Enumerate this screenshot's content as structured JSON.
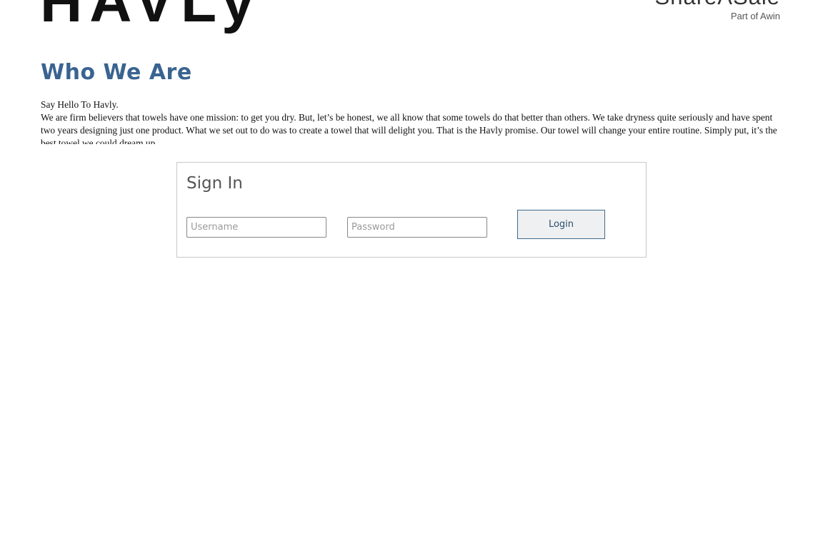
{
  "header": {
    "logo_text": "HAVLy",
    "brand_name": "ShareASale",
    "brand_sub": "Part of Awin"
  },
  "main": {
    "title": "Who We Are",
    "intro_heading": "Say Hello To Havly.",
    "intro_body": "We are firm believers that towels have one mission: to get you dry. But, let’s be honest, we all know that some towels do that better than others. We take dryness quite seriously and have spent two years designing just one product. What we set out to do was to create a towel that will delight you. That is the Havly promise. Our towel will change your entire routine. Simply put, it’s the best towel we could dream up."
  },
  "signin": {
    "title": "Sign In",
    "username_placeholder": "Username",
    "username_value": "",
    "password_placeholder": "Password",
    "password_value": "",
    "login_label": "Login"
  },
  "colors": {
    "title": "#3a6490",
    "button_border": "#3d6a8a",
    "button_bg": "#eef0f2"
  }
}
